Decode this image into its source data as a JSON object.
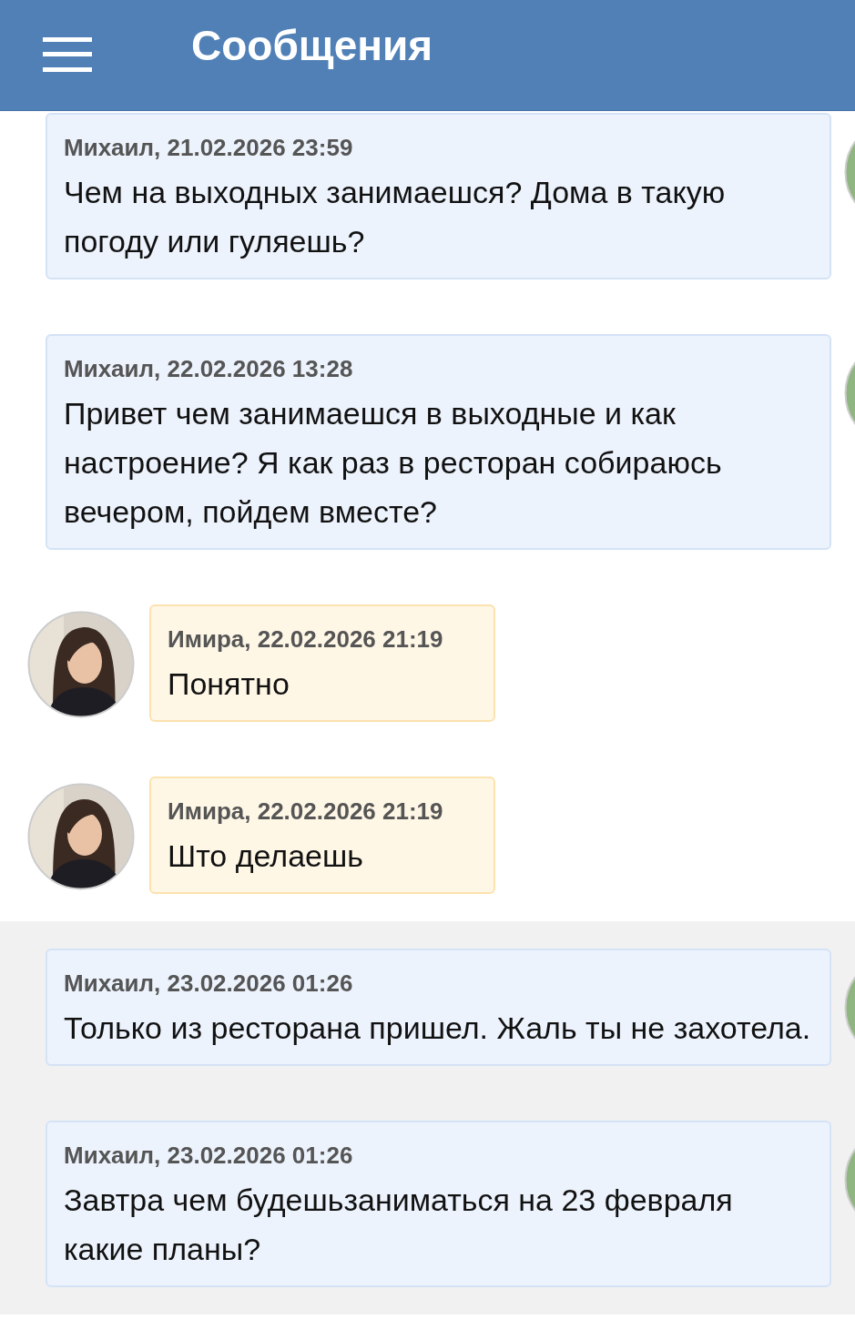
{
  "header": {
    "title": "Сообщения"
  },
  "messages": [
    {
      "kind": "outgoing",
      "author": "Михаил, 21.02.2026 23:59",
      "text": "Чем на выходных занимаешся? Дома в такую погоду или гуляешь?",
      "unread": false
    },
    {
      "kind": "outgoing",
      "author": "Михаил, 22.02.2026 13:28",
      "text": "Привет чем занимаешся в выходные и как настроение? Я как раз в ресторан собираюсь вечером, пойдем вместе?",
      "unread": false
    },
    {
      "kind": "incoming",
      "author": "Имира, 22.02.2026 21:19",
      "text": "Понятно",
      "unread": false
    },
    {
      "kind": "incoming",
      "author": "Имира, 22.02.2026 21:19",
      "text": "Што делаешь",
      "unread": false
    },
    {
      "kind": "outgoing",
      "author": "Михаил, 23.02.2026 01:26",
      "text": "Только из ресторана пришел. Жаль ты не захотела.",
      "unread": true
    },
    {
      "kind": "outgoing",
      "author": "Михаил, 23.02.2026 01:26",
      "text": "Завтра чем будешьзаниматься на 23 февраля какие планы?",
      "unread": true
    }
  ]
}
